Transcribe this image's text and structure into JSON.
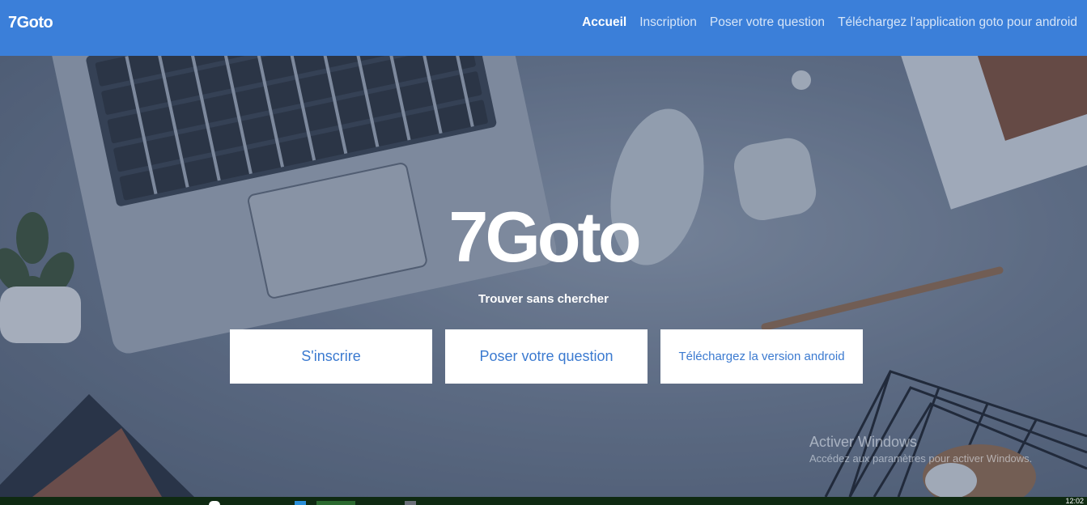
{
  "navbar": {
    "brand": "7Goto",
    "links": [
      {
        "label": "Accueil",
        "active": true
      },
      {
        "label": "Inscription",
        "active": false
      },
      {
        "label": "Poser votre question",
        "active": false
      },
      {
        "label": "Téléchargez l'application goto pour android",
        "active": false
      }
    ]
  },
  "hero": {
    "title": "7Goto",
    "subtitle": "Trouver sans chercher",
    "buttons": {
      "signup": "S'inscrire",
      "ask": "Poser votre question",
      "download": "Téléchargez la version android"
    }
  },
  "watermark": {
    "title": "Activer Windows",
    "subtitle": "Accédez aux paramètres pour activer Windows."
  },
  "taskbar": {
    "clock": "12:02"
  },
  "colors": {
    "navbar": "#3b7fd9",
    "button_text": "#3b7ad0",
    "taskbar": "#0f2a12"
  }
}
